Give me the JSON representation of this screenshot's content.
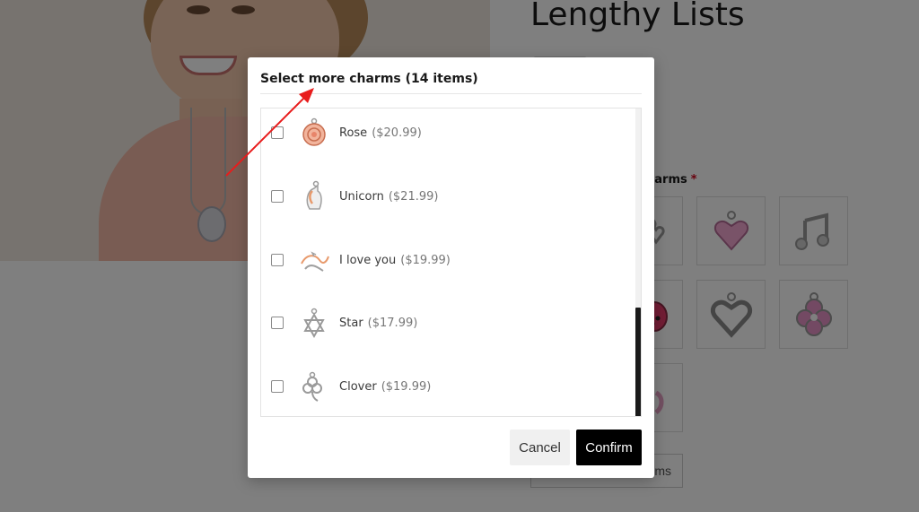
{
  "product": {
    "title": "Lengthy Lists",
    "charms_label": "harms",
    "required_mark": "*",
    "view_button_label": "ms"
  },
  "modal": {
    "title": "Select more charms (14 items)",
    "items": [
      {
        "name": "Rose",
        "price": "($20.99)",
        "icon": "rose-charm-icon",
        "checked": false
      },
      {
        "name": "Unicorn",
        "price": "($21.99)",
        "icon": "unicorn-charm-icon",
        "checked": false
      },
      {
        "name": "I love you",
        "price": "($19.99)",
        "icon": "i-love-you-charm-icon",
        "checked": false
      },
      {
        "name": "Star",
        "price": "($17.99)",
        "icon": "star-charm-icon",
        "checked": false
      },
      {
        "name": "Clover",
        "price": "($19.99)",
        "icon": "clover-charm-icon",
        "checked": false
      }
    ],
    "cancel_label": "Cancel",
    "confirm_label": "Confirm"
  },
  "colors": {
    "overlay": "#000000",
    "confirm_bg": "#000000",
    "annotation_arrow": "#e81c1c",
    "required": "#d0021b"
  }
}
